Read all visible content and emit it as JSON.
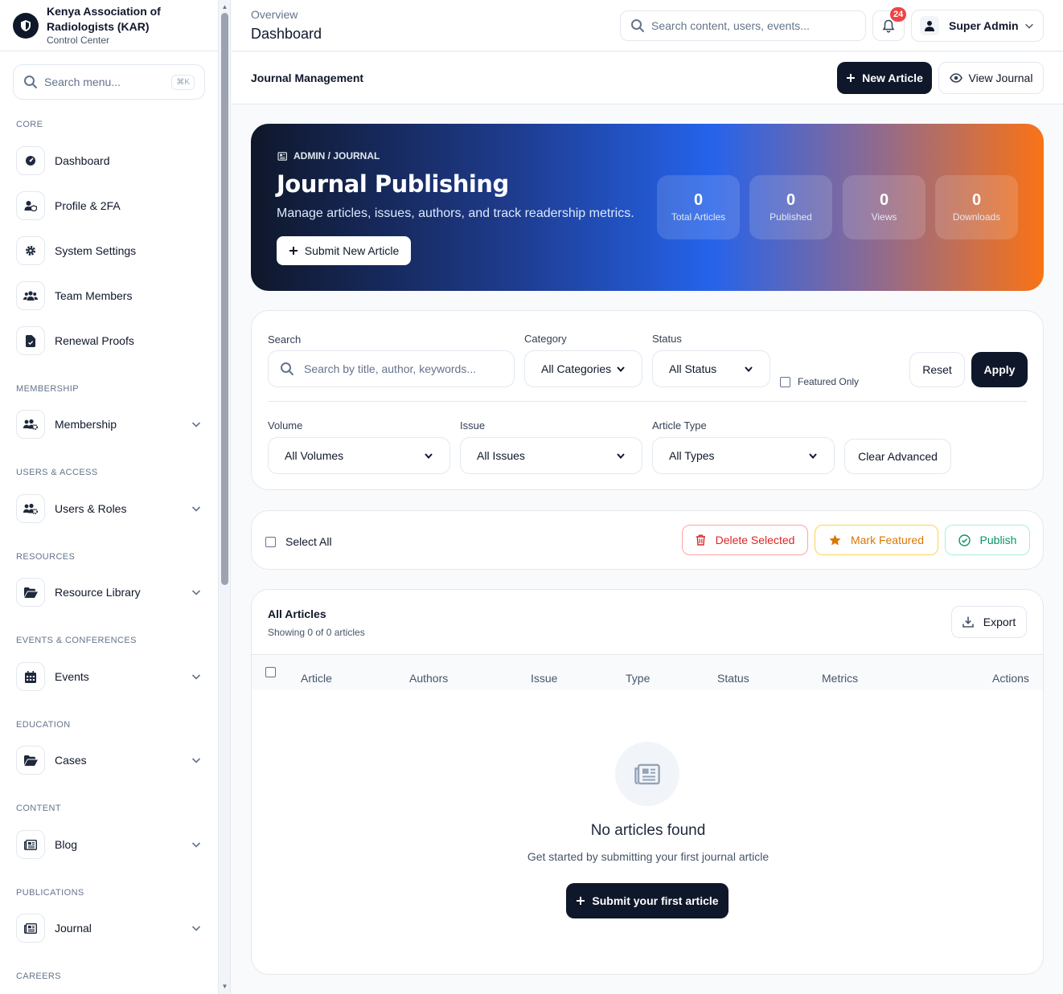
{
  "org": {
    "name_line1": "Kenya Association of",
    "name_line2": "Radiologists (KAR)",
    "subtitle": "Control Center"
  },
  "sidebar_search": {
    "placeholder": "Search menu...",
    "shortcut": "⌘K"
  },
  "sidebar": {
    "sections": [
      {
        "title": "CORE"
      },
      {
        "title": "MEMBERSHIP"
      },
      {
        "title": "USERS & ACCESS"
      },
      {
        "title": "RESOURCES"
      },
      {
        "title": "EVENTS & CONFERENCES"
      },
      {
        "title": "EDUCATION"
      },
      {
        "title": "CONTENT"
      },
      {
        "title": "PUBLICATIONS"
      },
      {
        "title": "CAREERS"
      }
    ],
    "items": [
      {
        "label": "Dashboard",
        "icon": "gauge-icon"
      },
      {
        "label": "Profile & 2FA",
        "icon": "user-shield-icon"
      },
      {
        "label": "System Settings",
        "icon": "gear-icon"
      },
      {
        "label": "Team Members",
        "icon": "users-icon"
      },
      {
        "label": "Renewal Proofs",
        "icon": "file-icon"
      },
      {
        "label": "Membership",
        "icon": "users-gear-icon"
      },
      {
        "label": "Users & Roles",
        "icon": "users-gear-icon"
      },
      {
        "label": "Resource Library",
        "icon": "folder-open-icon"
      },
      {
        "label": "Events",
        "icon": "calendar-icon"
      },
      {
        "label": "Cases",
        "icon": "folder-open-icon"
      },
      {
        "label": "Blog",
        "icon": "newspaper-icon"
      },
      {
        "label": "Journal",
        "icon": "newspaper-icon"
      }
    ]
  },
  "header": {
    "breadcrumb": "Overview",
    "title": "Dashboard",
    "search_placeholder": "Search content, users, events...",
    "notification_count": "24",
    "user_name": "Super Admin"
  },
  "subheader": {
    "title": "Journal Management",
    "new_article": "New Article",
    "view_journal": "View Journal"
  },
  "hero": {
    "eyebrow": "ADMIN / JOURNAL",
    "title": "Journal Publishing",
    "description": "Manage articles, issues, authors, and track readership metrics.",
    "cta": "Submit New Article",
    "stats": [
      {
        "value": "0",
        "label": "Total Articles"
      },
      {
        "value": "0",
        "label": "Published"
      },
      {
        "value": "0",
        "label": "Views"
      },
      {
        "value": "0",
        "label": "Downloads"
      }
    ]
  },
  "filters": {
    "search_label": "Search",
    "search_placeholder": "Search by title, author, keywords...",
    "category_label": "Category",
    "category_value": "All Categories",
    "status_label": "Status",
    "status_value": "All Status",
    "featured_only": "Featured Only",
    "reset": "Reset",
    "apply": "Apply",
    "volume_label": "Volume",
    "volume_value": "All Volumes",
    "issue_label": "Issue",
    "issue_value": "All Issues",
    "type_label": "Article Type",
    "type_value": "All Types",
    "clear_advanced": "Clear Advanced"
  },
  "bulk": {
    "select_all": "Select All",
    "delete": "Delete Selected",
    "feature": "Mark Featured",
    "publish": "Publish"
  },
  "articles": {
    "title": "All Articles",
    "count_text": "Showing 0 of 0 articles",
    "export": "Export",
    "columns": [
      "Article",
      "Authors",
      "Issue",
      "Type",
      "Status",
      "Metrics",
      "Actions"
    ],
    "empty_title": "No articles found",
    "empty_desc": "Get started by submitting your first journal article",
    "empty_cta": "Submit your first article"
  },
  "colors": {
    "primary": "#0f172a",
    "danger": "#dc2626",
    "warning": "#d97706",
    "success": "#059669",
    "badge": "#ef4444"
  }
}
